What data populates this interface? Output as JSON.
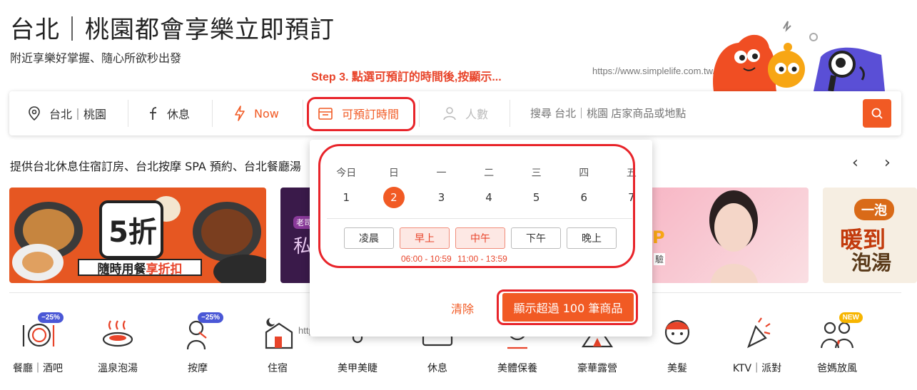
{
  "header": {
    "title": "台北｜桃園都會享樂立即預訂",
    "subtitle": "附近享樂好掌握、隨心所欲秒出發"
  },
  "annotation": {
    "step_caption": "Step 3. 點選可預訂的時間後,按顯示..."
  },
  "watermark": "https://www.simplelife.com.tw/",
  "search_bar": {
    "location": "台北｜桃園",
    "category": "休息",
    "now": "Now",
    "time": "可預訂時間",
    "people": "人數",
    "search_placeholder": "搜尋 台北｜桃園 店家商品或地點"
  },
  "intro_text": "提供台北休息住宿訂房、台北按摩 SPA 預約、台北餐廳湯",
  "carousel": {
    "prev": "‹",
    "next": "›"
  },
  "banners": {
    "banner1": {
      "big": "5折",
      "caption_a": "隨時用餐",
      "caption_b": "享折扣"
    },
    "banner2": {
      "tag": "老司",
      "text": "私"
    },
    "banner3": {
      "text": "P",
      "sub": "驗"
    },
    "banner4": {
      "top": "一泡",
      "line1": "暖到",
      "line2": "泡湯"
    }
  },
  "colors": {
    "accent": "#f15a24",
    "annotation_red": "#e8242a",
    "badge_blue": "#4a57d6",
    "badge_yellow": "#f7b500"
  },
  "calendar": {
    "weekdays": [
      "今日",
      "日",
      "一",
      "二",
      "三",
      "四",
      "五"
    ],
    "dates": [
      "1",
      "2",
      "3",
      "4",
      "5",
      "6",
      "7"
    ],
    "selected_date": "2",
    "slots": [
      "凌晨",
      "早上",
      "中午",
      "下午",
      "晚上"
    ],
    "active_slots": [
      "早上",
      "中午"
    ],
    "slot_times": {
      "morning": "06:00 - 10:59",
      "noon": "11:00 - 13:59"
    },
    "clear": "清除",
    "show": "顯示超過 100 筆商品"
  },
  "categories": [
    {
      "label": "餐廳｜酒吧",
      "icon": "dining-icon",
      "badge": "−25%"
    },
    {
      "label": "溫泉泡湯",
      "icon": "hot-spring-icon",
      "badge": ""
    },
    {
      "label": "按摩",
      "icon": "massage-icon",
      "badge": "−25%"
    },
    {
      "label": "住宿",
      "icon": "lodging-icon",
      "badge": ""
    },
    {
      "label": "美甲美睫",
      "icon": "nail-icon",
      "badge": ""
    },
    {
      "label": "休息",
      "icon": "rest-icon",
      "badge": ""
    },
    {
      "label": "美體保養",
      "icon": "body-care-icon",
      "badge": ""
    },
    {
      "label": "豪華露營",
      "icon": "glamping-icon",
      "badge": ""
    },
    {
      "label": "美髮",
      "icon": "hair-icon",
      "badge": ""
    },
    {
      "label": "KTV｜派對",
      "icon": "party-icon",
      "badge": ""
    },
    {
      "label": "爸媽放風",
      "icon": "family-icon",
      "badge": "NEW"
    }
  ]
}
